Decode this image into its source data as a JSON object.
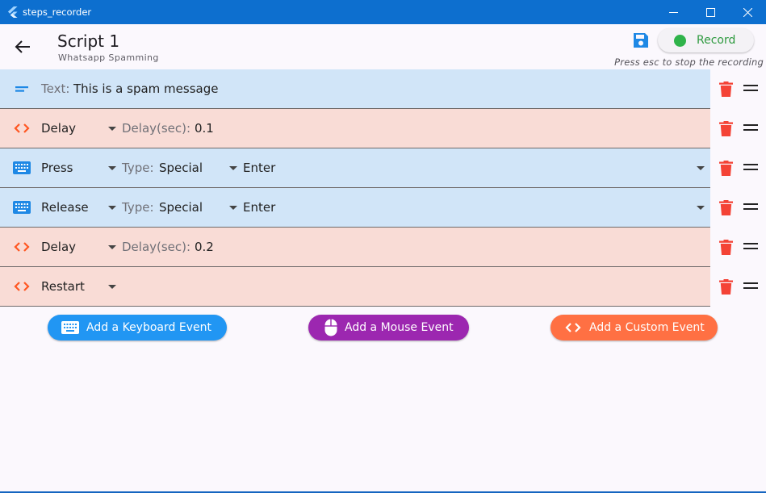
{
  "window": {
    "title": "steps_recorder",
    "accent": "#0d6fcf"
  },
  "header": {
    "title": "Script 1",
    "subtitle": "Whatsapp Spamming",
    "record_label": "Record",
    "hint": "Press esc to stop the recording"
  },
  "rows": [
    {
      "icon": "text-lines-icon",
      "color": "#d1e5f8",
      "label": "Text:",
      "value": "This is a spam message"
    },
    {
      "icon": "code-brackets-icon",
      "color": "#f9dcd6",
      "name": "Delay",
      "label": "Delay(sec):",
      "value": "0.1"
    },
    {
      "icon": "keyboard-icon",
      "color": "#d1e5f8",
      "name": "Press",
      "label": "Type:",
      "value": "Special",
      "key": "Enter"
    },
    {
      "icon": "keyboard-icon",
      "color": "#d1e5f8",
      "name": "Release",
      "label": "Type:",
      "value": "Special",
      "key": "Enter"
    },
    {
      "icon": "code-brackets-icon",
      "color": "#f9dcd6",
      "name": "Delay",
      "label": "Delay(sec):",
      "value": "0.2"
    },
    {
      "icon": "code-brackets-icon",
      "color": "#f9dcd6",
      "name": "Restart"
    }
  ],
  "actions": {
    "keyboard": "Add a Keyboard Event",
    "mouse": "Add a Mouse Event",
    "custom": "Add a Custom Event"
  },
  "colors": {
    "delete": "#f44336",
    "keyboard_btn": "#2196f3",
    "mouse_btn": "#9c27b0",
    "custom_btn": "#ff7043",
    "record_dot": "#2fb34a"
  }
}
